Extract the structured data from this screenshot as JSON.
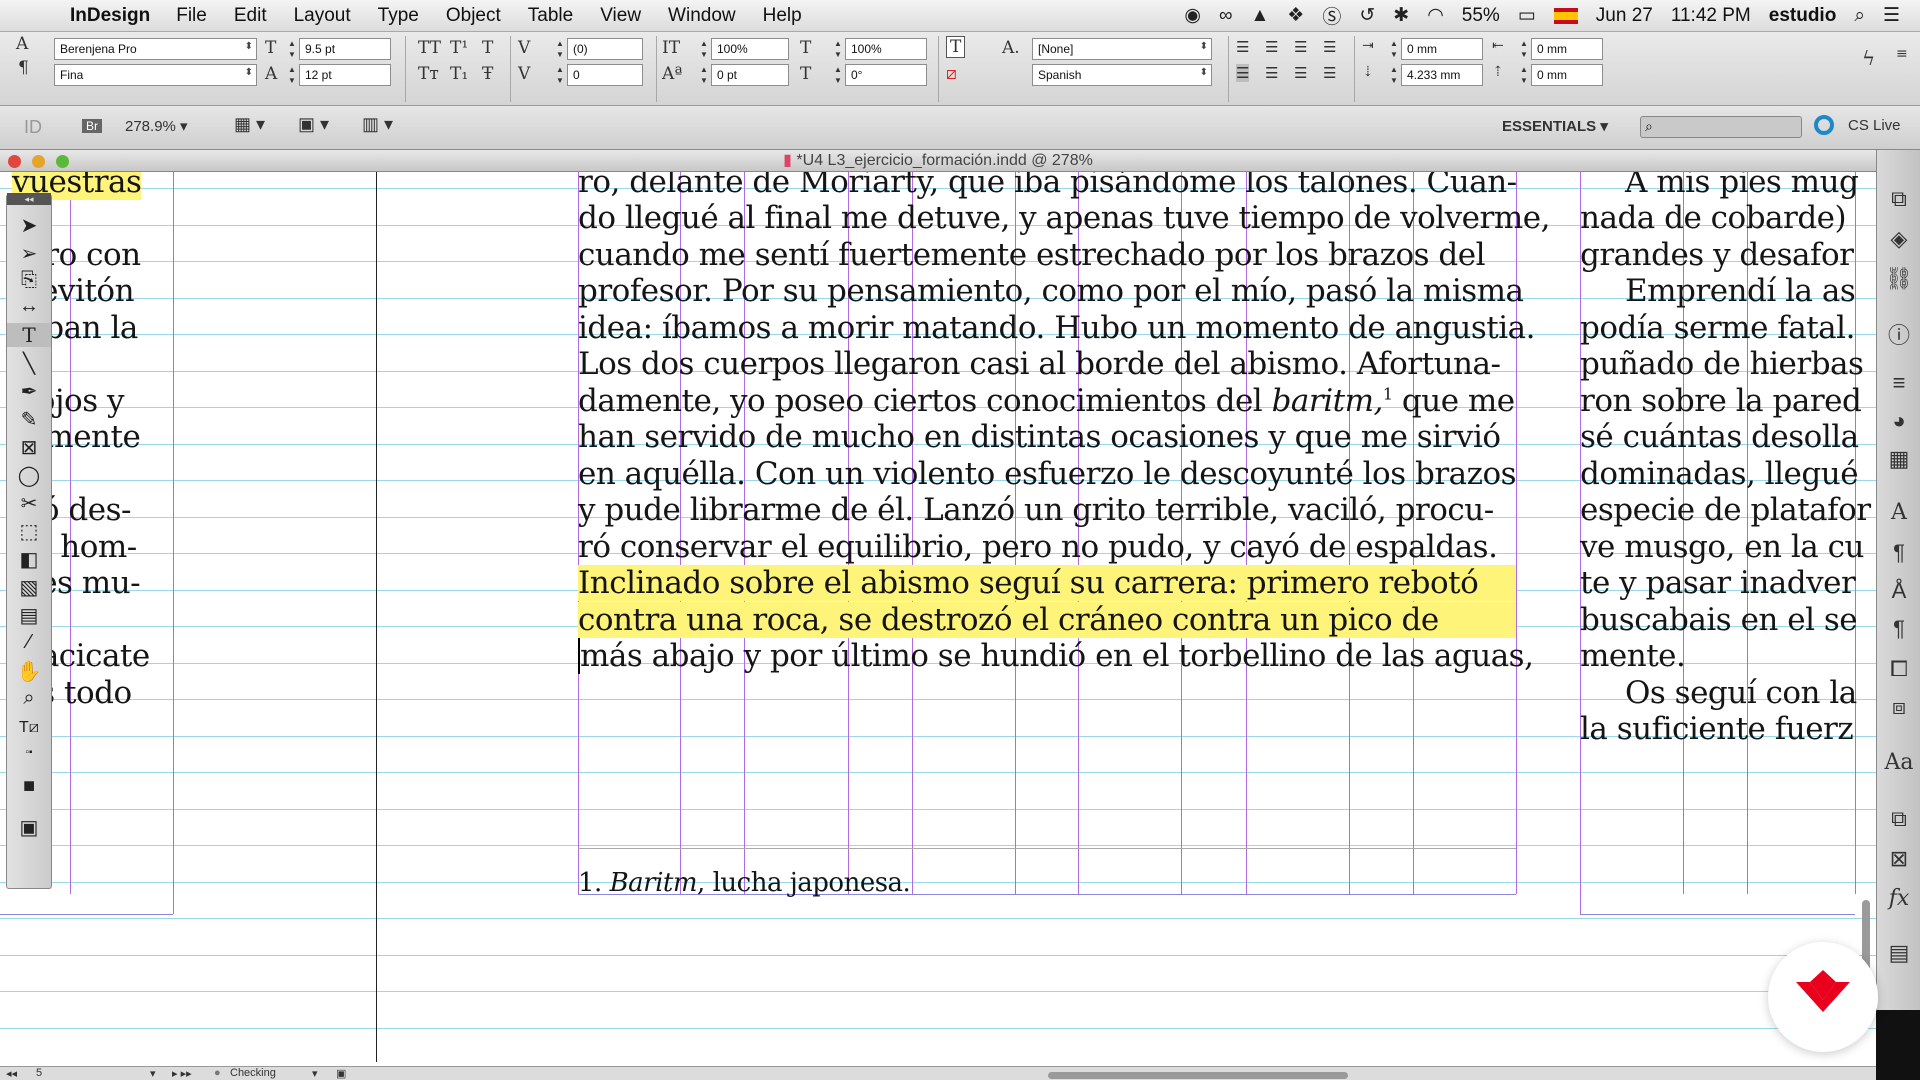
{
  "menubar": {
    "app_name": "InDesign",
    "menus": [
      "File",
      "Edit",
      "Layout",
      "Type",
      "Object",
      "Table",
      "View",
      "Window",
      "Help"
    ],
    "battery": "55%",
    "date": "Jun 27",
    "time": "11:42 PM",
    "user": "estudio"
  },
  "control_panel": {
    "font_family": "Berenjena Pro",
    "font_style": "Fina",
    "font_size": "9.5 pt",
    "leading": "12 pt",
    "kerning": "(0)",
    "tracking": "0",
    "vertical_scale": "100%",
    "horizontal_scale": "100%",
    "baseline_shift": "0 pt",
    "skew": "0°",
    "char_style": "[None]",
    "language": "Spanish",
    "left_indent": "0 mm",
    "right_indent": "0 mm",
    "space_before": "4.233 mm",
    "space_after": "0 mm"
  },
  "appbar": {
    "zoom": "278.9%",
    "workspace": "ESSENTIALS",
    "cs_live": "CS Live"
  },
  "document": {
    "title": "*U4 L3_ejercicio_formación.indd @ 278%"
  },
  "left_column": [
    "vuestras",
    "arro con",
    "l levitón",
    "raban la",
    "s ojos y",
    "ramente",
    "mó des-",
    "un hom-",
    "e es mu-",
    "n acicate",
    "éis todo"
  ],
  "main_text": [
    "ro, delante de Moriarty, que iba pisándome los talones. Cuan-",
    "do llegué al final me detuve, y apenas tuve tiempo de volverme,",
    "cuando me sentí fuertemente estrechado por los brazos del",
    "profesor. Por su pensamiento, como por el mío, pasó la misma",
    "idea: íbamos a morir matando. Hubo un momento de angustia.",
    "Los dos cuerpos llegaron casi al borde del abismo. Afortuna-",
    "damente, yo poseo ciertos conocimientos del ",
    "han servido de mucho en distintas ocasiones y que me sirvió",
    "en aquélla. Con un violento esfuerzo le descoyunté los brazos",
    "y pude librarme de él. Lanzó un grito terrible, vaciló, procu-",
    "ró conservar el equilibrio, pero no pudo, y cayó de espaldas.",
    "Inclinado sobre el abismo seguí su carrera: primero rebotó",
    "contra una roca, se destrozó el cráneo contra un pico de",
    "más abajo y por último se hundió en el torbellino de las aguas,"
  ],
  "main_text_italic": "baritm,",
  "main_text_sup": "1",
  "main_text_tail": " que me",
  "footnote": {
    "num": "1.",
    "italic": "Baritm",
    "rest": ", lucha japonesa."
  },
  "right_column": [
    "A mis pies mug",
    "nada de cobarde)",
    "grandes y desafor",
    "Emprendí la as",
    "podía serme fatal.",
    "puñado de hierbas",
    "ron sobre la pared",
    "sé cuántas desolla",
    "dominadas, llegué",
    "especie de platafor",
    "ve musgo, en la cu",
    "te y pasar inadver",
    "buscabais en el se",
    "mente.",
    "Os seguí con la",
    "la suficiente fuerz"
  ],
  "status": {
    "page": "5",
    "preflight": "Checking"
  },
  "colors": {
    "highlight": "#fff47a",
    "baseline_grid": "#9ad8e8",
    "margin_guide": "#b06be0",
    "logo": "#e8001c"
  }
}
